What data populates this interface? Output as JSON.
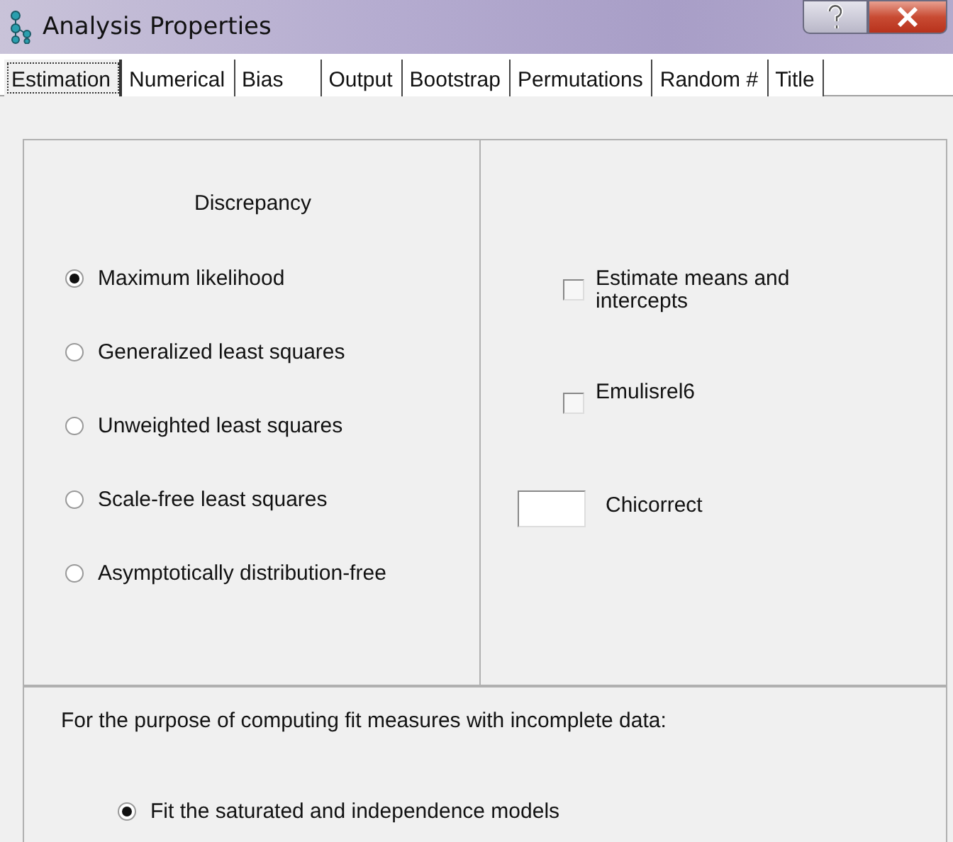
{
  "window": {
    "title": "Analysis Properties"
  },
  "tabs": [
    {
      "label": "Estimation",
      "selected": true
    },
    {
      "label": "Numerical",
      "selected": false
    },
    {
      "label": "Bias",
      "selected": false
    },
    {
      "label": "Output",
      "selected": false
    },
    {
      "label": "Bootstrap",
      "selected": false
    },
    {
      "label": "Permutations",
      "selected": false
    },
    {
      "label": "Random #",
      "selected": false
    },
    {
      "label": "Title",
      "selected": false
    }
  ],
  "discrepancy": {
    "heading": "Discrepancy",
    "options": [
      {
        "label": "Maximum likelihood",
        "selected": true
      },
      {
        "label": "Generalized least squares",
        "selected": false
      },
      {
        "label": "Unweighted least squares",
        "selected": false
      },
      {
        "label": "Scale-free least squares",
        "selected": false
      },
      {
        "label": "Asymptotically distribution-free",
        "selected": false
      }
    ]
  },
  "options": [
    {
      "kind": "checkbox",
      "label": "Estimate means and intercepts",
      "checked": false
    },
    {
      "kind": "checkbox",
      "label": "Emulisrel6",
      "checked": false
    },
    {
      "kind": "field",
      "label": "Chicorrect"
    }
  ],
  "incomplete_data": {
    "heading": "For the purpose of computing fit measures with incomplete data:",
    "options": [
      {
        "label": "Fit the saturated and independence models",
        "selected": true
      }
    ]
  }
}
